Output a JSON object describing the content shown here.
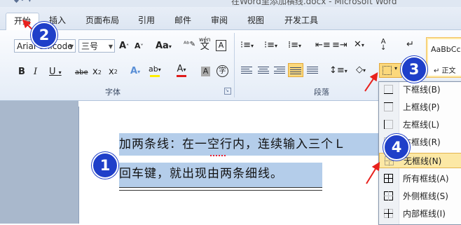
{
  "window": {
    "title": "在Word里添加横线.docx - Microsoft Word"
  },
  "tabs": [
    {
      "label": "开始",
      "active": true
    },
    {
      "label": "插入"
    },
    {
      "label": "页面布局"
    },
    {
      "label": "引用"
    },
    {
      "label": "邮件"
    },
    {
      "label": "审阅"
    },
    {
      "label": "视图"
    },
    {
      "label": "开发工具"
    }
  ],
  "font_group": {
    "font_name": "Arial Unicode",
    "font_size": "三号",
    "grow": "A",
    "shrink": "A",
    "case": "Aa",
    "pinyin": "wén",
    "pinyin_char": "文",
    "char_border": "A",
    "bold": "B",
    "italic": "I",
    "underline": "U",
    "strike": "abe",
    "sub": "x",
    "sup": "x",
    "highlight_letter": "A",
    "font_color_letter": "A",
    "shade_letter": "A",
    "enclose": "字",
    "label": "字体"
  },
  "paragraph_group": {
    "label": "段落",
    "sort": "A",
    "show_marks": "↵"
  },
  "styles_group": {
    "preview_1": "AaBbCc",
    "preview_2": "↵ 正文"
  },
  "document": {
    "line1": "加两条线：在一空行内，连续输入三个Ｌ",
    "line2": "回车键，就出现由两条细线。"
  },
  "border_menu": {
    "items": [
      {
        "label": "下框线(B)",
        "icon": "bottom-border-icon"
      },
      {
        "label": "上框线(P)",
        "icon": "top-border-icon"
      },
      {
        "label": "左框线(L)",
        "icon": "left-border-icon"
      },
      {
        "label": "右框线(R)",
        "icon": "right-border-icon"
      },
      {
        "label": "无框线(N)",
        "icon": "no-border-icon",
        "highlighted": true
      },
      {
        "label": "所有框线(A)",
        "icon": "all-borders-icon"
      },
      {
        "label": "外侧框线(S)",
        "icon": "outside-borders-icon"
      },
      {
        "label": "内部框线(I)",
        "icon": "inside-borders-icon"
      }
    ]
  },
  "callouts": [
    "1",
    "2",
    "3",
    "4"
  ],
  "colors": {
    "accent_highlight": "#fce8a5",
    "callout": "#1f3fc9",
    "arrow": "#e8211d",
    "selection": "#b4cdea"
  }
}
